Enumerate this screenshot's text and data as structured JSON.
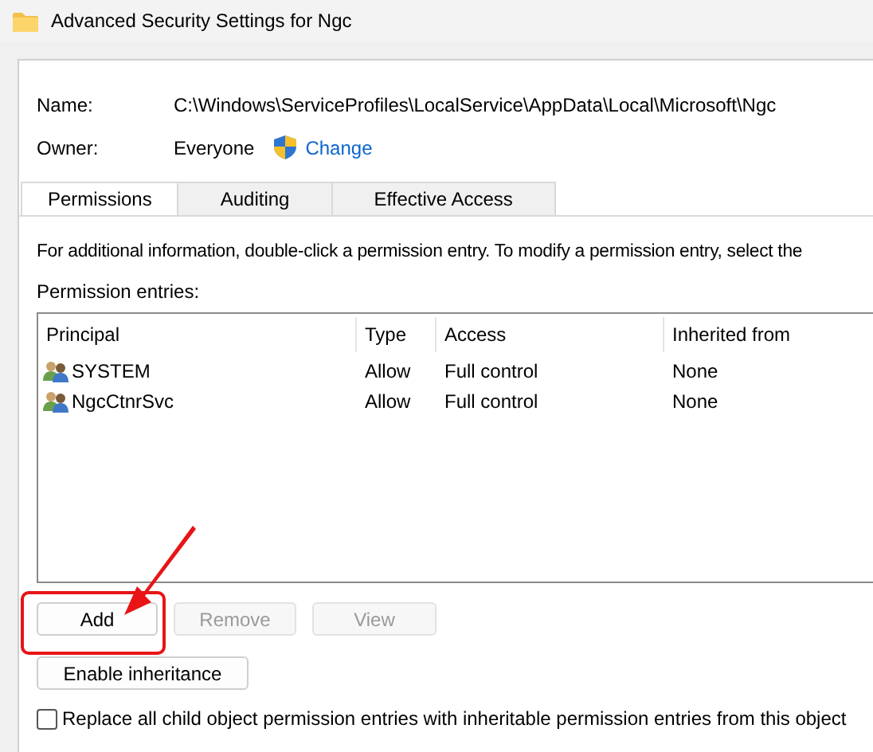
{
  "window": {
    "title": "Advanced Security Settings for Ngc"
  },
  "name": {
    "label": "Name:",
    "value": "C:\\Windows\\ServiceProfiles\\LocalService\\AppData\\Local\\Microsoft\\Ngc"
  },
  "owner": {
    "label": "Owner:",
    "value": "Everyone",
    "link": "Change"
  },
  "tabs": [
    {
      "label": "Permissions",
      "selected": true
    },
    {
      "label": "Auditing",
      "selected": false
    },
    {
      "label": "Effective Access",
      "selected": false
    }
  ],
  "info": "For additional information, double-click a permission entry. To modify a permission entry, select the",
  "entries_label": "Permission entries:",
  "table": {
    "columns": [
      "Principal",
      "Type",
      "Access",
      "Inherited from"
    ],
    "rows": [
      [
        "SYSTEM",
        "Allow",
        "Full control",
        "None"
      ],
      [
        "NgcCtnrSvc",
        "Allow",
        "Full control",
        "None"
      ]
    ]
  },
  "buttons": [
    {
      "label": "Add",
      "disabled": false,
      "highlighted": true
    },
    {
      "label": "Remove",
      "disabled": true,
      "highlighted": false
    },
    {
      "label": "View",
      "disabled": true,
      "highlighted": false
    }
  ],
  "inheritance_button": {
    "label": "Enable inheritance"
  },
  "replace_checkbox": {
    "label": "Replace all child object permission entries with inheritable permission entries from this object",
    "checked": false
  }
}
